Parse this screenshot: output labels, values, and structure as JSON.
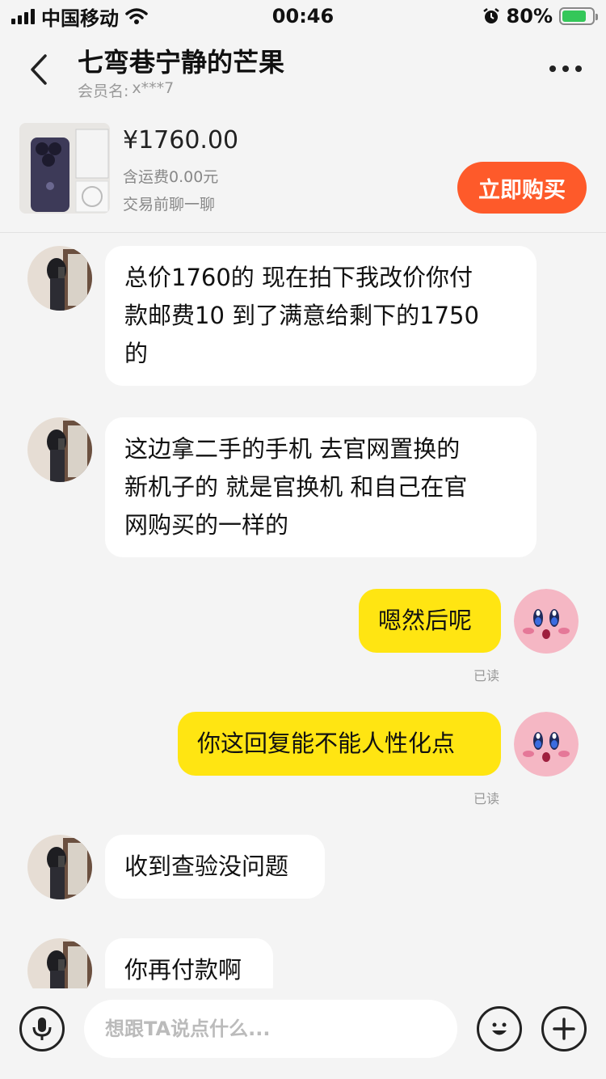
{
  "status_bar": {
    "carrier": "中国移动",
    "time": "00:46",
    "battery": "80%",
    "battery_level": 0.8
  },
  "header": {
    "title": "七弯巷宁静的芒果",
    "member_label": "会员名:",
    "member_id": "x***7"
  },
  "product": {
    "price": "¥1760.00",
    "shipping": "含运费0.00元",
    "chat_hint": "交易前聊一聊",
    "buy_label": "立即购买"
  },
  "messages": [
    {
      "side": "left",
      "lines": [
        "总价1760的 现在拍下我改价你付",
        "款邮费10 到了满意给剩下的1750",
        "的"
      ]
    },
    {
      "side": "left",
      "lines": [
        "这边拿二手的手机 去官网置换的",
        "新机子的  就是官换机 和自己在官",
        "网购买的一样的"
      ]
    },
    {
      "side": "right",
      "lines": [
        "嗯然后呢"
      ],
      "status": "已读"
    },
    {
      "side": "right",
      "lines": [
        "你这回复能不能人性化点"
      ],
      "status": "已读"
    },
    {
      "side": "left",
      "lines": [
        "收到查验没问题"
      ]
    },
    {
      "side": "left",
      "lines": [
        "你再付款啊"
      ]
    }
  ],
  "input": {
    "placeholder": "想跟TA说点什么..."
  },
  "icons": {
    "back": "chevron-left-icon",
    "more": "more-dots-icon",
    "mic": "microphone-icon",
    "emoji": "emoji-icon",
    "plus": "plus-icon"
  },
  "colors": {
    "buy_button": "#fe5a2a",
    "my_bubble": "#ffe512",
    "their_bubble": "#ffffff",
    "background": "#f4f4f4"
  }
}
